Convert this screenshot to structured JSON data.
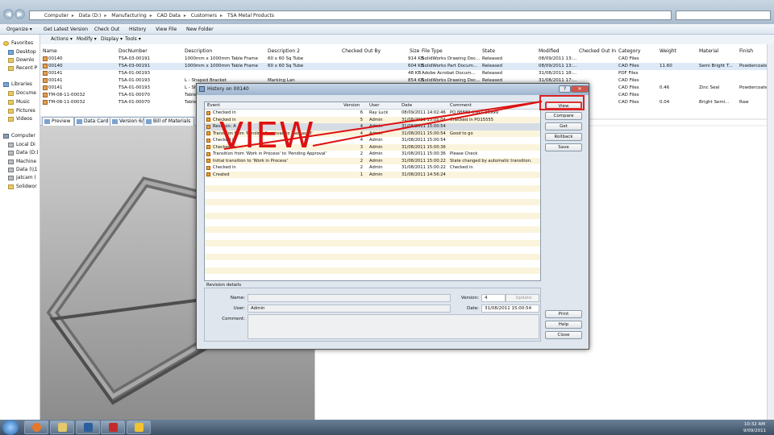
{
  "address": {
    "crumbs": [
      "Computer",
      "Data (D:)",
      "Manufacturing",
      "CAD Data",
      "Customers",
      "TSA Metal Products"
    ]
  },
  "commandbar": {
    "organize": "Organize ▾",
    "get_latest": "Get Latest Version",
    "check_out": "Check Out",
    "history": "History",
    "view_file": "View File",
    "new_folder": "New Folder"
  },
  "toolbar": {
    "actions": "Actions ▾",
    "modify": "Modify ▾",
    "display": "Display ▾",
    "tools": "Tools ▾"
  },
  "nav": {
    "favorites": "Favorites",
    "desktop": "Desktop",
    "downloads": "Downlo",
    "recent": "Recent P",
    "libraries": "Libraries",
    "documents": "Docume",
    "music": "Music",
    "pictures": "Pictures",
    "videos": "Videos",
    "computer": "Computer",
    "local_disk": "Local Di",
    "data": "Data (D:)",
    "machine": "Machine",
    "data_net": "Data (\\\\1",
    "jatcam": "Jatcam (",
    "solidworks": "Solidwor"
  },
  "columns": {
    "name": "Name",
    "docnumber": "DocNumber",
    "description": "Description",
    "description2": "Description 2",
    "checked_out_by": "Checked Out By",
    "size": "Size",
    "filetype": "File Type",
    "state": "State",
    "modified": "Modified",
    "checked_out_in": "Checked Out In",
    "category": "Category",
    "weight": "Weight",
    "material": "Material",
    "finish": "Finish"
  },
  "files": [
    {
      "name": "00140",
      "doc": "TSA-03-00191",
      "desc": "1000mm x 1000mm Table Frame",
      "desc2": "60 x 60 Sq Tube",
      "size": "914 KB",
      "type": "SolidWorks Drawing Doc...",
      "state": "Released",
      "modified": "08/09/2011 13:...",
      "category": "CAD Files",
      "weight": "",
      "material": "",
      "finish": ""
    },
    {
      "name": "00140",
      "doc": "TSA-03-00191",
      "desc": "1000mm x 1000mm Table Frame",
      "desc2": "60 x 60 Sq Tube",
      "size": "604 KB",
      "type": "SolidWorks Part Docum...",
      "state": "Released",
      "modified": "08/09/2011 13:...",
      "category": "CAD Files",
      "weight": "11.60",
      "material": "Semi Bright T...",
      "finish": "Powdercoate"
    },
    {
      "name": "00141",
      "doc": "TSA-01-00193",
      "desc": "",
      "desc2": "",
      "size": "48 KB",
      "type": "Adobe Acrobat Docum...",
      "state": "Released",
      "modified": "31/08/2011 18:...",
      "category": "PDF Files",
      "weight": "",
      "material": "",
      "finish": ""
    },
    {
      "name": "00141",
      "doc": "TSA-01-00193",
      "desc": "L - Shaped Bracket",
      "desc2": "Marking Lan",
      "size": "854 KB",
      "type": "SolidWorks Drawing Doc...",
      "state": "Released",
      "modified": "31/08/2011 17:...",
      "category": "CAD Files",
      "weight": "",
      "material": "",
      "finish": ""
    },
    {
      "name": "00141",
      "doc": "TSA-01-00193",
      "desc": "L - Sh",
      "desc2": "",
      "size": "",
      "type": "",
      "state": "",
      "modified": "",
      "category": "CAD Files",
      "weight": "0.46",
      "material": "Zinc Seal",
      "finish": "Powdercoate"
    },
    {
      "name": "TM-08-11-00032",
      "doc": "TSA-01-00070",
      "desc": "Table",
      "desc2": "",
      "size": "",
      "type": "",
      "state": "",
      "modified": "",
      "category": "CAD Files",
      "weight": "",
      "material": "",
      "finish": ""
    },
    {
      "name": "TM-08-11-00032",
      "doc": "TSA-01-00070",
      "desc": "Table",
      "desc2": "",
      "size": "",
      "type": "",
      "state": "",
      "modified": "",
      "category": "CAD Files",
      "weight": "0.04",
      "material": "Bright Semi...",
      "finish": "Raw"
    }
  ],
  "tabs": [
    "Preview",
    "Data Card",
    "Version 6/6",
    "Bill of Materials"
  ],
  "dialog": {
    "title": "History on 00140",
    "minimize": "?",
    "close": "✕",
    "headers": {
      "event": "Event",
      "version": "Version",
      "user": "User",
      "date": "Date",
      "comment": "Comment"
    },
    "rows": [
      {
        "event": "Checked in",
        "version": "6",
        "user": "Ray Luck",
        "date": "08/09/2011 14:02:46",
        "comment": "PO 88888 (HW): 99999"
      },
      {
        "event": "Checked in",
        "version": "5",
        "user": "Admin",
        "date": "31/08/2011 15:05:04",
        "comment": "Checked in PO15555"
      },
      {
        "event": "Revision: A",
        "version": "4",
        "user": "Admin",
        "date": "31/08/2011 15:00:54",
        "comment": ""
      },
      {
        "event": "Transition from 'Pending Approval' to 'Released'",
        "version": "4",
        "user": "Admin",
        "date": "31/08/2011 15:00:54",
        "comment": "Good to go"
      },
      {
        "event": "Checked in",
        "version": "4",
        "user": "Admin",
        "date": "31/08/2011 15:00:54",
        "comment": ""
      },
      {
        "event": "Checked in",
        "version": "3",
        "user": "Admin",
        "date": "31/08/2011 15:00:36",
        "comment": ""
      },
      {
        "event": "Transition from 'Work in Process' to 'Pending Approval'",
        "version": "2",
        "user": "Admin",
        "date": "31/08/2011 15:00:36",
        "comment": "Please Check"
      },
      {
        "event": "Initial transition to 'Work in Process'",
        "version": "2",
        "user": "Admin",
        "date": "31/08/2011 15:00:22",
        "comment": "State changed by automatic transition."
      },
      {
        "event": "Checked in",
        "version": "2",
        "user": "Admin",
        "date": "31/08/2011 15:00:22",
        "comment": "Checked in"
      },
      {
        "event": "Created",
        "version": "1",
        "user": "Admin",
        "date": "31/08/2011 14:56:24",
        "comment": ""
      }
    ],
    "buttons": {
      "view": "View",
      "compare": "Compare",
      "get": "Get",
      "rollback": "Rollback",
      "save": "Save",
      "print": "Print",
      "help": "Help",
      "close": "Close"
    },
    "details": {
      "section": "Revision details",
      "name_label": "Name:",
      "name_value": "",
      "user_label": "User:",
      "user_value": "Admin",
      "comment_label": "Comment:",
      "comment_value": "",
      "version_label": "Version:",
      "version_value": "4",
      "update_label": "Update",
      "date_label": "Date:",
      "date_value": "31/08/2011 15:00:54"
    }
  },
  "annotation": {
    "text": "VIEW",
    "color": "#dd1111"
  },
  "taskbar": {
    "time": "10:32 AM",
    "date": "9/09/2011"
  }
}
